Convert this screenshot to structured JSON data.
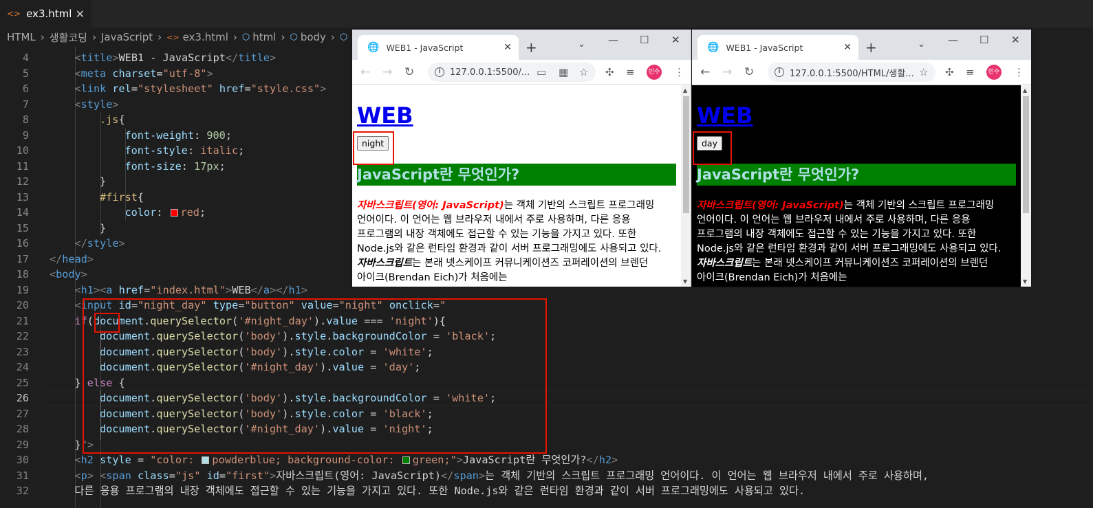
{
  "editor": {
    "tab": {
      "filename": "ex3.html",
      "close": "✕"
    },
    "breadcrumbs": [
      "HTML",
      "생활코딩",
      "JavaScript",
      "ex3.html",
      "html",
      "body"
    ],
    "current_line": "26"
  },
  "browser_light": {
    "tab_title": "WEB1 - JavaScript",
    "url": "127.0.0.1:5500/...",
    "avatar": "민수",
    "heading": "WEB",
    "button": "night",
    "h2": "JavaScript란 무엇인가?",
    "para_js": "자바스크립트(영어: JavaScript)",
    "para_1": "는 객체 기반의 스크립트 프로그래밍 언어이다. 이 언어는 웹 브라우저 내에서 주로 사용하며, 다른 응용 프로그램의 내장 객체에도 접근할 수 있는 기능을 가지고 있다. 또한 Node.js와 같은 런타임 환경과 같이 서버 프로그래밍에도 사용되고 있다. ",
    "para_bold": "자바스크립트",
    "para_2": "는 본래 넷스케이프 커뮤니케이션즈 코퍼레이션의 브렌던 아이크(Brendan Eich)가 처음에는",
    "bg": "#ffffff",
    "fg": "#000000"
  },
  "browser_dark": {
    "tab_title": "WEB1 - JavaScript",
    "url": "127.0.0.1:5500/HTML/생활...",
    "avatar": "민수",
    "heading": "WEB",
    "button": "day",
    "h2": "JavaScript란 무엇인가?",
    "para_js": "자바스크립트(영어: JavaScript)",
    "para_1": "는 객체 기반의 스크립트 프로그래밍 언어이다. 이 언어는 웹 브라우저 내에서 주로 사용하며, 다른 응용 프로그램의 내장 객체에도 접근할 수 있는 기능을 가지고 있다. 또한 Node.js와 같은 런타임 환경과 같이 서버 프로그래밍에도 사용되고 있다. ",
    "para_bold": "자바스크립트",
    "para_2": "는 본래 넷스케이프 커뮤니케이션즈 코퍼레이션의 브렌던 아이크(Brendan Eich)가 처음에는",
    "bg": "#000000",
    "fg": "#ffffff"
  },
  "code_lines": [
    {
      "n": "4",
      "indent": 2,
      "tokens": [
        [
          "tb",
          "<"
        ],
        [
          "t",
          "title"
        ],
        [
          "tb",
          ">"
        ],
        [
          "c",
          "WEB1 - JavaScript"
        ],
        [
          "tb",
          "</"
        ],
        [
          "t",
          "title"
        ],
        [
          "tb",
          ">"
        ]
      ]
    },
    {
      "n": "5",
      "indent": 2,
      "tokens": [
        [
          "tb",
          "<"
        ],
        [
          "t",
          "meta"
        ],
        [
          "c",
          " "
        ],
        [
          "a",
          "charset"
        ],
        [
          "c",
          "="
        ],
        [
          "s",
          "\"utf-8\""
        ],
        [
          "tb",
          ">"
        ]
      ]
    },
    {
      "n": "6",
      "indent": 2,
      "tokens": [
        [
          "tb",
          "<"
        ],
        [
          "t",
          "link"
        ],
        [
          "c",
          " "
        ],
        [
          "a",
          "rel"
        ],
        [
          "c",
          "="
        ],
        [
          "s",
          "\"stylesheet\""
        ],
        [
          "c",
          " "
        ],
        [
          "a",
          "href"
        ],
        [
          "c",
          "="
        ],
        [
          "s",
          "\"style.css\""
        ],
        [
          "tb",
          ">"
        ]
      ]
    },
    {
      "n": "7",
      "indent": 2,
      "tokens": [
        [
          "tb",
          "<"
        ],
        [
          "t",
          "style"
        ],
        [
          "tb",
          ">"
        ]
      ]
    },
    {
      "n": "8",
      "indent": 3,
      "tokens": [
        [
          "p",
          ".js"
        ],
        [
          "c",
          "{"
        ]
      ]
    },
    {
      "n": "9",
      "indent": 4,
      "tokens": [
        [
          "a",
          "font-weight"
        ],
        [
          "c",
          ": "
        ],
        [
          "n",
          "900"
        ],
        [
          "c",
          ";"
        ]
      ]
    },
    {
      "n": "10",
      "indent": 4,
      "tokens": [
        [
          "a",
          "font-style"
        ],
        [
          "c",
          ": "
        ],
        [
          "s",
          "italic"
        ],
        [
          "c",
          ";"
        ]
      ]
    },
    {
      "n": "11",
      "indent": 4,
      "tokens": [
        [
          "a",
          "font-size"
        ],
        [
          "c",
          ": "
        ],
        [
          "n",
          "17px"
        ],
        [
          "c",
          ";"
        ]
      ]
    },
    {
      "n": "12",
      "indent": 3,
      "tokens": [
        [
          "c",
          "}"
        ]
      ]
    },
    {
      "n": "13",
      "indent": 3,
      "tokens": [
        [
          "p",
          "#first"
        ],
        [
          "c",
          "{"
        ]
      ]
    },
    {
      "n": "14",
      "indent": 4,
      "tokens": [
        [
          "a",
          "color"
        ],
        [
          "c",
          ": "
        ],
        [
          "sw",
          "#ff0000"
        ],
        [
          "s",
          "red"
        ],
        [
          "c",
          ";"
        ]
      ]
    },
    {
      "n": "15",
      "indent": 3,
      "tokens": [
        [
          "c",
          "}"
        ]
      ]
    },
    {
      "n": "16",
      "indent": 2,
      "tokens": [
        [
          "tb",
          "</"
        ],
        [
          "t",
          "style"
        ],
        [
          "tb",
          ">"
        ]
      ]
    },
    {
      "n": "17",
      "indent": 1,
      "tokens": [
        [
          "tb",
          "</"
        ],
        [
          "t",
          "head"
        ],
        [
          "tb",
          ">"
        ]
      ]
    },
    {
      "n": "18",
      "indent": 1,
      "tokens": [
        [
          "tb",
          "<"
        ],
        [
          "t",
          "body"
        ],
        [
          "tb",
          ">"
        ]
      ]
    },
    {
      "n": "19",
      "indent": 2,
      "tokens": [
        [
          "tb",
          "<"
        ],
        [
          "t",
          "h1"
        ],
        [
          "tb",
          "><"
        ],
        [
          "t",
          "a"
        ],
        [
          "c",
          " "
        ],
        [
          "a",
          "href"
        ],
        [
          "c",
          "="
        ],
        [
          "s",
          "\"index.html\""
        ],
        [
          "tb",
          ">"
        ],
        [
          "c",
          "WEB"
        ],
        [
          "tb",
          "</"
        ],
        [
          "t",
          "a"
        ],
        [
          "tb",
          "></"
        ],
        [
          "t",
          "h1"
        ],
        [
          "tb",
          ">"
        ]
      ]
    },
    {
      "n": "20",
      "indent": 2,
      "tokens": [
        [
          "tb",
          "<"
        ],
        [
          "t",
          "input"
        ],
        [
          "c",
          " "
        ],
        [
          "a",
          "id"
        ],
        [
          "c",
          "="
        ],
        [
          "s",
          "\"night_day\""
        ],
        [
          "c",
          " "
        ],
        [
          "a",
          "type"
        ],
        [
          "c",
          "="
        ],
        [
          "s",
          "\"button\""
        ],
        [
          "c",
          " "
        ],
        [
          "a",
          "value"
        ],
        [
          "c",
          "="
        ],
        [
          "s",
          "\"night\""
        ],
        [
          "c",
          " "
        ],
        [
          "a",
          "onclick"
        ],
        [
          "c",
          "="
        ],
        [
          "s",
          "\""
        ]
      ]
    },
    {
      "n": "21",
      "indent": 2,
      "tokens": [
        [
          "k",
          "if"
        ],
        [
          "c",
          "("
        ],
        [
          "v",
          "document"
        ],
        [
          "c",
          "."
        ],
        [
          "f",
          "querySelector"
        ],
        [
          "c",
          "("
        ],
        [
          "s",
          "'#night_day'"
        ],
        [
          "c",
          ")."
        ],
        [
          "v",
          "value"
        ],
        [
          "c",
          " === "
        ],
        [
          "s",
          "'night'"
        ],
        [
          "c",
          "){"
        ]
      ]
    },
    {
      "n": "22",
      "indent": 3,
      "tokens": [
        [
          "v",
          "document"
        ],
        [
          "c",
          "."
        ],
        [
          "f",
          "querySelector"
        ],
        [
          "c",
          "("
        ],
        [
          "s",
          "'body'"
        ],
        [
          "c",
          ")."
        ],
        [
          "v",
          "style"
        ],
        [
          "c",
          "."
        ],
        [
          "v",
          "backgroundColor"
        ],
        [
          "c",
          " = "
        ],
        [
          "s",
          "'black'"
        ],
        [
          "c",
          ";"
        ]
      ]
    },
    {
      "n": "23",
      "indent": 3,
      "tokens": [
        [
          "v",
          "document"
        ],
        [
          "c",
          "."
        ],
        [
          "f",
          "querySelector"
        ],
        [
          "c",
          "("
        ],
        [
          "s",
          "'body'"
        ],
        [
          "c",
          ")."
        ],
        [
          "v",
          "style"
        ],
        [
          "c",
          "."
        ],
        [
          "v",
          "color"
        ],
        [
          "c",
          " = "
        ],
        [
          "s",
          "'white'"
        ],
        [
          "c",
          ";"
        ]
      ]
    },
    {
      "n": "24",
      "indent": 3,
      "tokens": [
        [
          "v",
          "document"
        ],
        [
          "c",
          "."
        ],
        [
          "f",
          "querySelector"
        ],
        [
          "c",
          "("
        ],
        [
          "s",
          "'#night_day'"
        ],
        [
          "c",
          ")."
        ],
        [
          "v",
          "value"
        ],
        [
          "c",
          " = "
        ],
        [
          "s",
          "'day'"
        ],
        [
          "c",
          ";"
        ]
      ]
    },
    {
      "n": "25",
      "indent": 2,
      "tokens": [
        [
          "c",
          "} "
        ],
        [
          "k",
          "else"
        ],
        [
          "c",
          " {"
        ]
      ]
    },
    {
      "n": "26",
      "indent": 3,
      "tokens": [
        [
          "v",
          "document"
        ],
        [
          "c",
          "."
        ],
        [
          "f",
          "querySelector"
        ],
        [
          "c",
          "("
        ],
        [
          "s",
          "'body'"
        ],
        [
          "c",
          ")."
        ],
        [
          "v",
          "style"
        ],
        [
          "c",
          "."
        ],
        [
          "v",
          "backgroundColor"
        ],
        [
          "c",
          " = "
        ],
        [
          "s",
          "'white'"
        ],
        [
          "c",
          ";"
        ]
      ]
    },
    {
      "n": "27",
      "indent": 3,
      "tokens": [
        [
          "v",
          "document"
        ],
        [
          "c",
          "."
        ],
        [
          "f",
          "querySelector"
        ],
        [
          "c",
          "("
        ],
        [
          "s",
          "'body'"
        ],
        [
          "c",
          ")."
        ],
        [
          "v",
          "style"
        ],
        [
          "c",
          "."
        ],
        [
          "v",
          "color"
        ],
        [
          "c",
          " = "
        ],
        [
          "s",
          "'black'"
        ],
        [
          "c",
          ";"
        ]
      ]
    },
    {
      "n": "28",
      "indent": 3,
      "tokens": [
        [
          "v",
          "document"
        ],
        [
          "c",
          "."
        ],
        [
          "f",
          "querySelector"
        ],
        [
          "c",
          "("
        ],
        [
          "s",
          "'#night_day'"
        ],
        [
          "c",
          ")."
        ],
        [
          "v",
          "value"
        ],
        [
          "c",
          " = "
        ],
        [
          "s",
          "'night'"
        ],
        [
          "c",
          ";"
        ]
      ]
    },
    {
      "n": "29",
      "indent": 2,
      "tokens": [
        [
          "c",
          "}"
        ],
        [
          "s",
          "\""
        ],
        [
          "tb",
          ">"
        ]
      ]
    },
    {
      "n": "30",
      "indent": 2,
      "tokens": [
        [
          "tb",
          "<"
        ],
        [
          "t",
          "h2"
        ],
        [
          "c",
          " "
        ],
        [
          "a",
          "style"
        ],
        [
          "c",
          " = "
        ],
        [
          "s",
          "\"color: "
        ],
        [
          "sw",
          "#b0e0e6"
        ],
        [
          "s",
          "powderblue; background-color: "
        ],
        [
          "sw",
          "#008000"
        ],
        [
          "s",
          "green;\""
        ],
        [
          "tb",
          ">"
        ],
        [
          "c",
          "JavaScript란 무엇인가?"
        ],
        [
          "tb",
          "</"
        ],
        [
          "t",
          "h2"
        ],
        [
          "tb",
          ">"
        ]
      ]
    },
    {
      "n": "31",
      "indent": 2,
      "tokens": [
        [
          "tb",
          "<"
        ],
        [
          "t",
          "p"
        ],
        [
          "tb",
          ">"
        ],
        [
          "c",
          " "
        ],
        [
          "tb",
          "<"
        ],
        [
          "t",
          "span"
        ],
        [
          "c",
          " "
        ],
        [
          "a",
          "class"
        ],
        [
          "c",
          "="
        ],
        [
          "s",
          "\"js\""
        ],
        [
          "c",
          " "
        ],
        [
          "a",
          "id"
        ],
        [
          "c",
          "="
        ],
        [
          "s",
          "\"first\""
        ],
        [
          "tb",
          ">"
        ],
        [
          "c",
          "자바스크립트(영어: JavaScript)"
        ],
        [
          "tb",
          "</"
        ],
        [
          "t",
          "span"
        ],
        [
          "tb",
          ">"
        ],
        [
          "c",
          "는 객체 기반의 스크립트 프로그래밍 언어이다. 이 언어는 웹 브라우저 내에서 주로 사용하며,"
        ]
      ]
    },
    {
      "n": "32",
      "indent": 2,
      "tokens": [
        [
          "c",
          "다른 응용 프로그램의 내장 객체에도 접근할 수 있는 기능을 가지고 있다. 또한 Node.js와 같은 런타임 환경과 같이 서버 프로그래밍에도 사용되고 있다."
        ]
      ]
    }
  ]
}
